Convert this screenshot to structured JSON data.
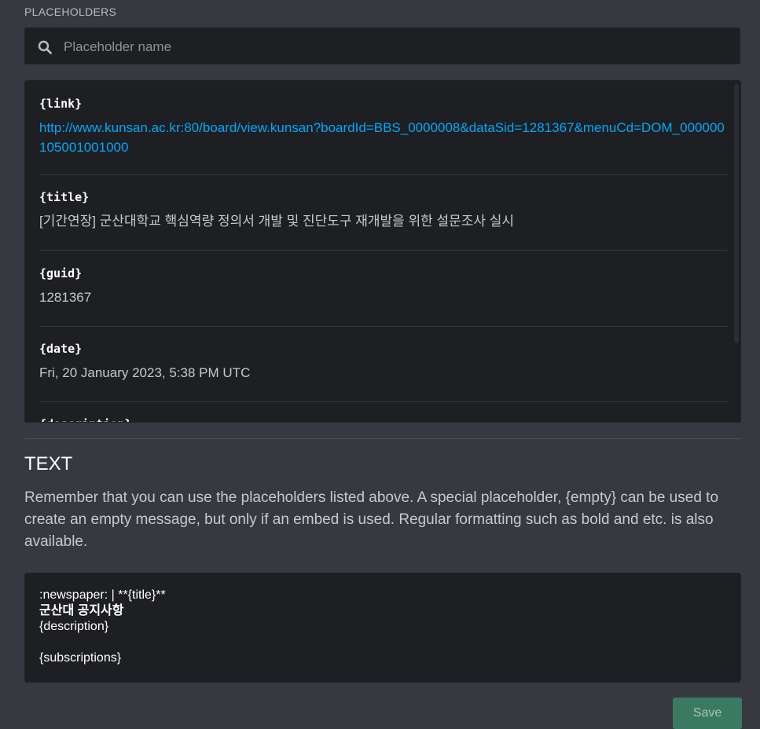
{
  "placeholders_section": {
    "title": "PLACEHOLDERS",
    "search_placeholder": "Placeholder name",
    "items": [
      {
        "key": "{link}",
        "value": "http://www.kunsan.ac.kr:80/board/view.kunsan?boardId=BBS_0000008&dataSid=1281367&menuCd=DOM_000000105001001000"
      },
      {
        "key": "{title}",
        "value": "[기간연장] 군산대학교 핵심역량 정의서 개발 및 진단도구 재개발을 위한 설문조사 실시"
      },
      {
        "key": "{guid}",
        "value": "1281367"
      },
      {
        "key": "{date}",
        "value": "Fri, 20 January 2023, 5:38 PM UTC"
      },
      {
        "key": "{description}",
        "value": ""
      }
    ]
  },
  "text_section": {
    "title": "TEXT",
    "description": "Remember that you can use the placeholders listed above. A special placeholder, {empty} can be used to create an empty message, but only if an embed is used. Regular formatting such as bold and etc. is also available.",
    "editor_lines": [
      ":newspaper:  |  **{title}**",
      "군산대 공지사항",
      "{description}",
      "",
      "{subscriptions}"
    ]
  },
  "save_button_label": "Save",
  "colors": {
    "background": "#36393f",
    "panel": "#1e1f22",
    "link": "#00a8fc",
    "save": "#3a7a62"
  }
}
